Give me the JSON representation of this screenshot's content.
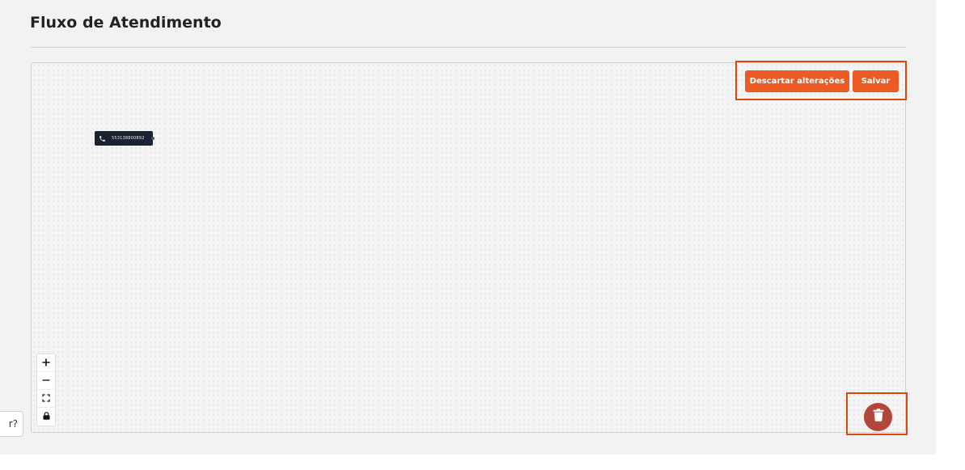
{
  "header": {
    "title": "Fluxo de Atendimento"
  },
  "toolbar": {
    "discard_label": "Descartar alterações",
    "save_label": "Salvar"
  },
  "flow": {
    "nodes": [
      {
        "icon": "phone-icon",
        "label": "553138800892"
      }
    ]
  },
  "canvas_controls": [
    {
      "icon": "zoom-in-icon",
      "glyph": "+"
    },
    {
      "icon": "zoom-out-icon",
      "glyph": "—"
    },
    {
      "icon": "fit-view-icon"
    },
    {
      "icon": "lock-icon"
    }
  ],
  "delete": {
    "icon": "trash-icon"
  },
  "side_tab": {
    "text": "r?"
  },
  "colors": {
    "accent": "#ee5a24",
    "highlight_border": "#e0440f",
    "node_bg": "#1b2233",
    "trash_bg": "#b1473c",
    "page_bg": "#f2f2f2"
  }
}
